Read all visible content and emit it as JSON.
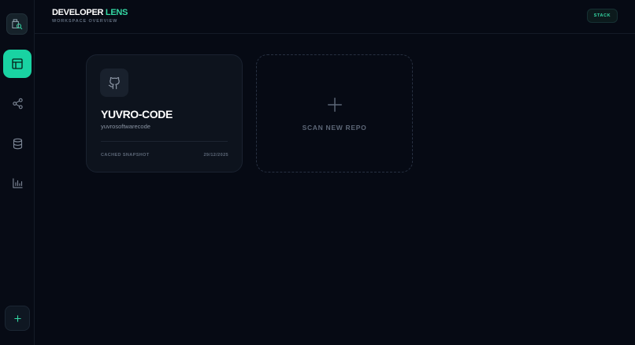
{
  "header": {
    "title_main": "DEVELOPER",
    "title_accent": "LENS",
    "subtitle": "WORKSPACE OVERVIEW",
    "stack_button": "STACK"
  },
  "sidebar": {
    "items": [
      {
        "icon": "layout-icon",
        "active": true
      },
      {
        "icon": "share-nodes-icon",
        "active": false
      },
      {
        "icon": "database-icon",
        "active": false
      },
      {
        "icon": "bar-chart-icon",
        "active": false
      }
    ],
    "add_icon": "plus-icon"
  },
  "repo_card": {
    "icon": "github-icon",
    "name": "YUVRO-CODE",
    "owner": "yuvrosoftwarecode",
    "status": "CACHED SNAPSHOT",
    "date": "29/12/2025"
  },
  "scan_card": {
    "icon": "plus-icon",
    "label": "SCAN NEW REPO"
  },
  "colors": {
    "background": "#060a14",
    "accent": "#19d3a2",
    "accent_text": "#34d8a4",
    "card": "#0d131d"
  }
}
